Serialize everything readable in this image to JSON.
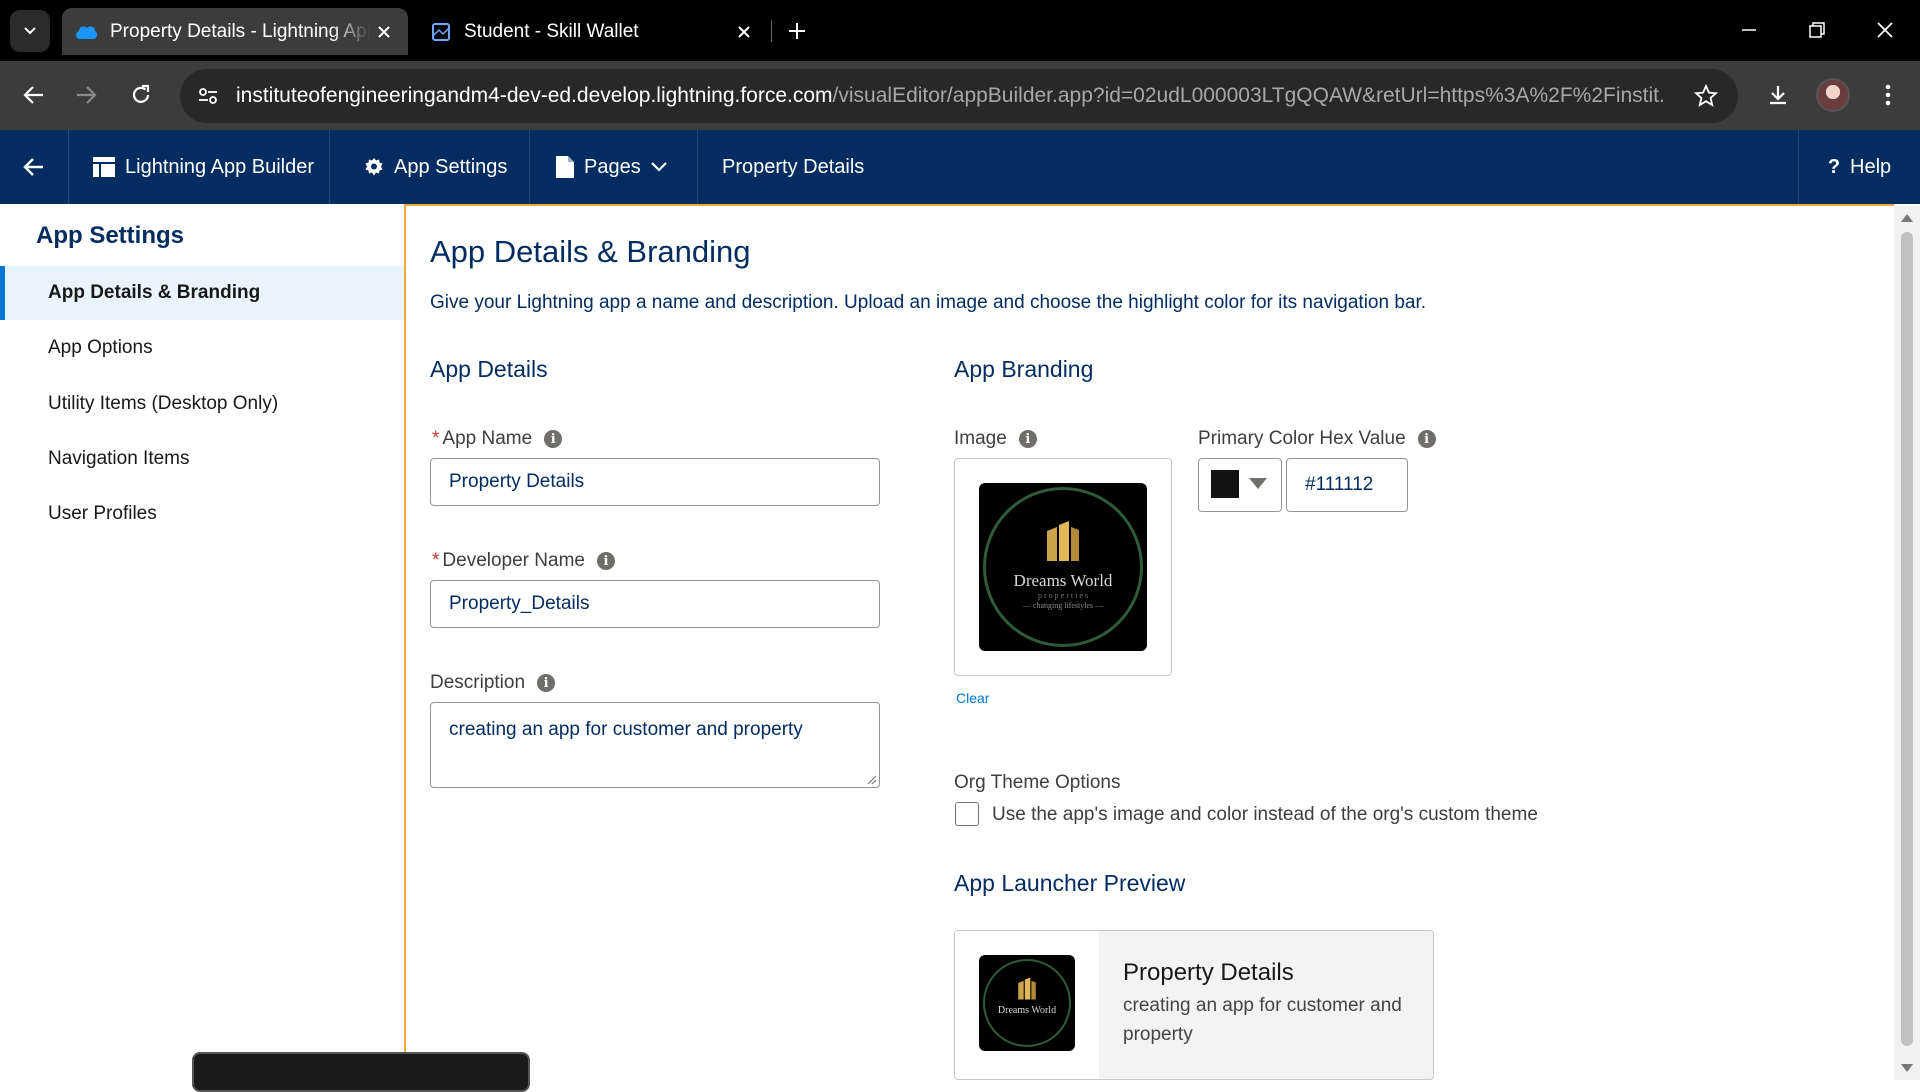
{
  "browser": {
    "tabs": [
      {
        "title": "Property Details - Lightning App Builder",
        "active": true
      },
      {
        "title": "Student - Skill Wallet",
        "active": false
      }
    ],
    "url_host": "instituteofengineeringandm4-dev-ed.develop.lightning.force.com",
    "url_path": "/visualEditor/appBuilder.app?id=02udL000003LTgQQAW&retUrl=https%3A%2F%2Finstit..."
  },
  "header": {
    "lightning_app_builder": "Lightning App Builder",
    "app_settings": "App Settings",
    "pages": "Pages",
    "current_page": "Property Details",
    "help": "Help"
  },
  "sidebar": {
    "title": "App Settings",
    "items": [
      {
        "label": "App Details & Branding",
        "active": true
      },
      {
        "label": "App Options",
        "active": false
      },
      {
        "label": "Utility Items (Desktop Only)",
        "active": false
      },
      {
        "label": "Navigation Items",
        "active": false
      },
      {
        "label": "User Profiles",
        "active": false
      }
    ]
  },
  "main": {
    "title": "App Details & Branding",
    "description": "Give your Lightning app a name and description. Upload an image and choose the highlight color for its navigation bar.",
    "app_details": {
      "heading": "App Details",
      "app_name_label": "App Name",
      "app_name_value": "Property Details",
      "developer_name_label": "Developer Name",
      "developer_name_value": "Property_Details",
      "description_label": "Description",
      "description_value": "creating an app for customer and property",
      "required_mark": "*"
    },
    "app_branding": {
      "heading": "App Branding",
      "image_label": "Image",
      "logo_name": "Dreams World",
      "logo_sub1": "p r o p e r t i e s",
      "logo_sub2": "— changing lifestyles —",
      "clear_link": "Clear",
      "primary_color_label": "Primary Color Hex Value",
      "primary_color_value": "#111112",
      "org_theme_label": "Org Theme Options",
      "org_theme_checkbox_label": "Use the app's image and color instead of the org's custom theme",
      "org_theme_checked": false
    },
    "launcher_preview": {
      "heading": "App Launcher Preview",
      "app_name": "Property Details",
      "app_description": "creating an app for customer and property"
    }
  },
  "colors": {
    "sf_header": "#032d60",
    "accent_blue": "#0176d3",
    "panel_border": "#f4a640",
    "primary_color": "#111112"
  }
}
